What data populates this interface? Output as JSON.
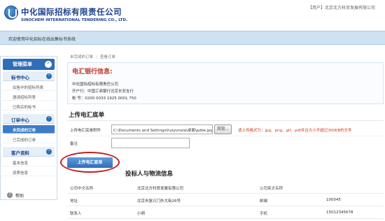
{
  "header": {
    "company_cn": "中化国际招标有限责任公司",
    "company_en": "SINOCHEM INTERNATIONAL TENDERING CO., LTD.",
    "top_right": "【用户】北京北方科贸发展有限公司"
  },
  "navbar": {
    "welcome": "欢迎使用中化招标在线出售标书系统"
  },
  "sidebar": {
    "menu_title": "管理菜单",
    "groups": [
      {
        "title": "标书中心",
        "items": [
          "出售中的招标列表",
          "邀请招标列表",
          "已购买的标书"
        ]
      },
      {
        "title": "订单中心",
        "items": [
          "未完成的订单",
          "已完成的订单"
        ]
      },
      {
        "title": "客户资料",
        "items": [
          "基本信息",
          "资质信息"
        ]
      }
    ],
    "help_label": "帮助"
  },
  "breadcrumb": {
    "parent": "未完成的订单",
    "current": "查看订单"
  },
  "bank_info": {
    "title": "电汇银行信息:",
    "company": "中化国际招标有限责任公司",
    "bank": "开户行：中国工商银行北京长安支行",
    "account": "帐  号：0200 0033 1925 0001 750"
  },
  "upload": {
    "title": "上传电汇底单",
    "file_label": "上传电汇底单附件",
    "file_value": "C:\\Documents and Settings\\huiyunxia\\桌面\\pzbe.jpg",
    "browse_label": "浏览...",
    "hint": "请上传格式为：jpg、png、gif、pdf并且大小不超过300KB的文件",
    "note_label": "备注",
    "submit_label": "上传电汇底单"
  },
  "bidder": {
    "title": "投标人与物流信息",
    "rows": [
      {
        "label1": "公司中文名称",
        "value1": "北京北方科贸发展有限公司",
        "label2": "公司英文名称",
        "value2": ""
      },
      {
        "label1": "地址",
        "value1": "北京市复兴门外大街26号",
        "label2": "邮编",
        "value2": "100045"
      },
      {
        "label1": "联系人",
        "value1": "小明",
        "label2": "手机",
        "value2": "15012345678"
      }
    ]
  },
  "colors": {
    "brand_blue": "#1b3f8f",
    "accent_blue": "#2f6db6",
    "title_red": "#c0392b",
    "hint_red": "#d03a16",
    "annotation_red": "#c21f1f"
  }
}
